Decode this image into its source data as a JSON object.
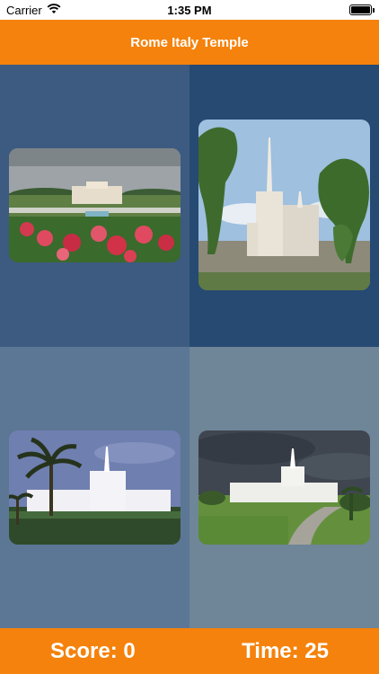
{
  "status_bar": {
    "carrier": "Carrier",
    "time": "1:35 PM"
  },
  "nav": {
    "title": "Rome Italy Temple"
  },
  "tiles": [
    {
      "name": "temple-photo-laie"
    },
    {
      "name": "temple-photo-rome"
    },
    {
      "name": "temple-photo-palms"
    },
    {
      "name": "temple-photo-storm"
    }
  ],
  "footer": {
    "score": "Score: 0",
    "time": "Time: 25"
  },
  "colors": {
    "accent": "#f5820c",
    "tile1": "#3d5b80",
    "tile2": "#264a72",
    "tile3": "#5b7795",
    "tile4": "#6f8598"
  }
}
